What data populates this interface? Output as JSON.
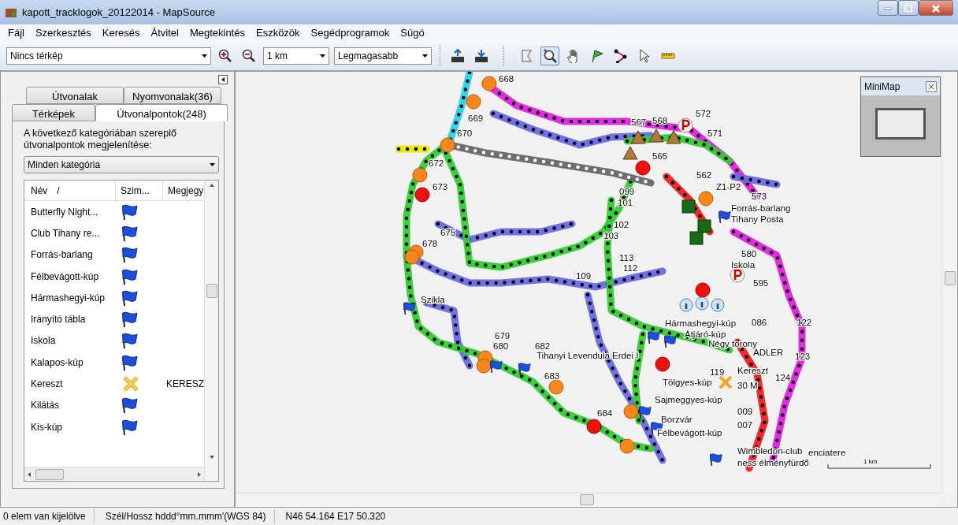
{
  "window": {
    "title": "kapott_tracklogok_20122014 - MapSource"
  },
  "menu": [
    "Fájl",
    "Szerkesztés",
    "Keresés",
    "Átvitel",
    "Megtekintés",
    "Eszközök",
    "Segédprogramok",
    "Súgó"
  ],
  "toolbar": {
    "map_select": "Nincs térkép",
    "scale_select": "1 km",
    "detail_select": "Legmagasabb",
    "tools": [
      {
        "kind": "polygon",
        "selected": false
      },
      {
        "kind": "zoom",
        "selected": true
      },
      {
        "kind": "hand",
        "selected": false
      },
      {
        "kind": "flag",
        "selected": false
      },
      {
        "kind": "route",
        "selected": false
      },
      {
        "kind": "pointer",
        "selected": false
      },
      {
        "kind": "ruler",
        "selected": false
      }
    ]
  },
  "sidebar": {
    "tab_rows": [
      [
        {
          "label": "Útvonalak",
          "selected": false
        },
        {
          "label": "Nyomvonalak(36)",
          "selected": false
        }
      ],
      [
        {
          "label": "Térképek",
          "selected": false
        },
        {
          "label": "Útvonalpontok(248)",
          "selected": true
        }
      ]
    ],
    "filter_label": "A következő kategóriában szereplő útvonalpontok megjelenítése:",
    "filter_select": "Minden kategória",
    "columns": [
      "Név",
      "/",
      "Szim...",
      "Megjegy"
    ],
    "rows": [
      {
        "name": "Butterfly Night...",
        "kind": "flag"
      },
      {
        "name": "Club Tihany re...",
        "kind": "flag"
      },
      {
        "name": "Forrás-barlang",
        "kind": "flag"
      },
      {
        "name": "Félbevágott-kúp",
        "kind": "flag"
      },
      {
        "name": "Hármashegyi-kúp",
        "kind": "flag"
      },
      {
        "name": "Irányító tábla",
        "kind": "flag"
      },
      {
        "name": "Iskola",
        "kind": "flag"
      },
      {
        "name": "Kalapos-kúp",
        "kind": "flag"
      },
      {
        "name": "Kereszt",
        "kind": "cross",
        "note": "KERESZ"
      },
      {
        "name": "Kilátás",
        "kind": "flag"
      },
      {
        "name": "Kis-kúp",
        "kind": "flag"
      }
    ]
  },
  "map": {
    "labels": [
      "668",
      "669",
      "670",
      "672",
      "673",
      "675",
      "678",
      "567",
      "568",
      "572",
      "571",
      "565",
      "562",
      "Z1-P2",
      "573",
      "Forrás-barlang",
      "Tihany Posta",
      "099",
      "101",
      "102",
      "103",
      "113",
      "112",
      "109",
      "580",
      "Iskola",
      "595",
      "Szikla",
      "679",
      "680",
      "682",
      "Tihanyi Levendula Erdei I",
      "683",
      "684",
      "Hármashegyi-kúp",
      "Átjáró-kúp",
      "086",
      "122",
      "Négy torony",
      "ADLER",
      "123",
      "119",
      "Kereszt",
      "124",
      "Tölgyes-kúp",
      "30 M",
      "Sajmeggyes-kúp",
      "009",
      "007",
      "Borzvár",
      "Félbevágott-kúp",
      "Wimbledon-club",
      "enciatere",
      "ness élményfürdő"
    ],
    "scale_label": "1 km",
    "minimap_title": "MiniMap"
  },
  "status_bar": [
    "0 elem van kijelölve",
    "Szél/Hossz hddd°mm.mmm'(WGS 84)",
    "N46 54.164 E17 50.320"
  ]
}
